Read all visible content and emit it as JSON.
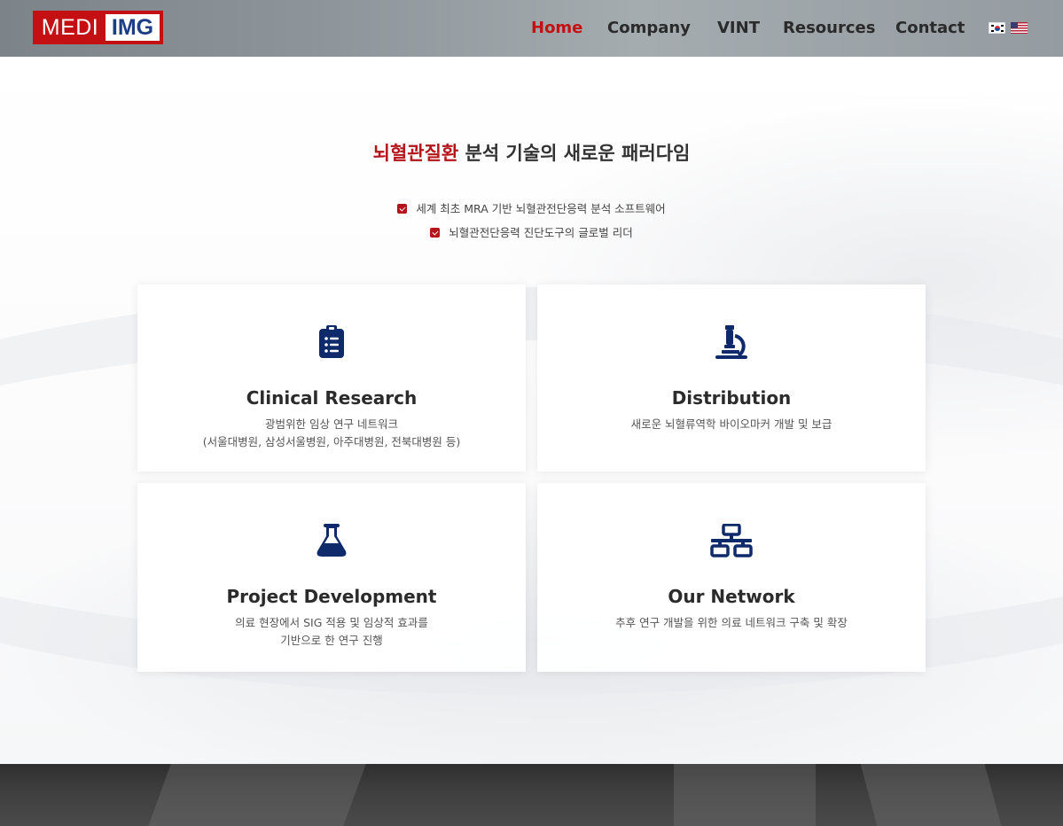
{
  "logo": {
    "part1": "MEDI",
    "part2": "IMG"
  },
  "nav": {
    "items": [
      "Home",
      "Company",
      "VINT",
      "Resources",
      "Contact"
    ],
    "active": "Home"
  },
  "languages": [
    {
      "name": "korean-flag",
      "code": "ko"
    },
    {
      "name": "us-flag",
      "code": "en"
    }
  ],
  "hero": {
    "headline_accent": "뇌혈관질환",
    "headline_rest": " 분석 기술의 새로운 패러다임",
    "checks": [
      "세계 최초 MRA 기반 뇌혈관전단응력 분석 소프트웨어",
      "뇌혈관전단응력 진단도구의 글로벌 리더"
    ]
  },
  "cards": [
    {
      "icon": "clipboard-list-icon",
      "title": "Clinical Research",
      "desc1": "광범위한 임상 연구 네트워크",
      "desc2": "(서울대병원, 삼성서울병원, 아주대병원, 전북대병원 등)"
    },
    {
      "icon": "microscope-icon",
      "title": "Distribution",
      "desc1": "새로운 뇌혈류역학 바이오마커 개발 및 보급",
      "desc2": ""
    },
    {
      "icon": "flask-icon",
      "title": "Project Development",
      "desc1": "의료 현장에서 SIG 적용 및 임상적 효과를",
      "desc2": "기반으로 한 연구 진행"
    },
    {
      "icon": "network-icon",
      "title": "Our Network",
      "desc1": "추후 연구 개발을 위한 의료 네트워크 구축 및 확장",
      "desc2": ""
    }
  ],
  "colors": {
    "accent": "#c40f13",
    "icon": "#0f2a6b",
    "logo_blue": "#1b3e87"
  }
}
